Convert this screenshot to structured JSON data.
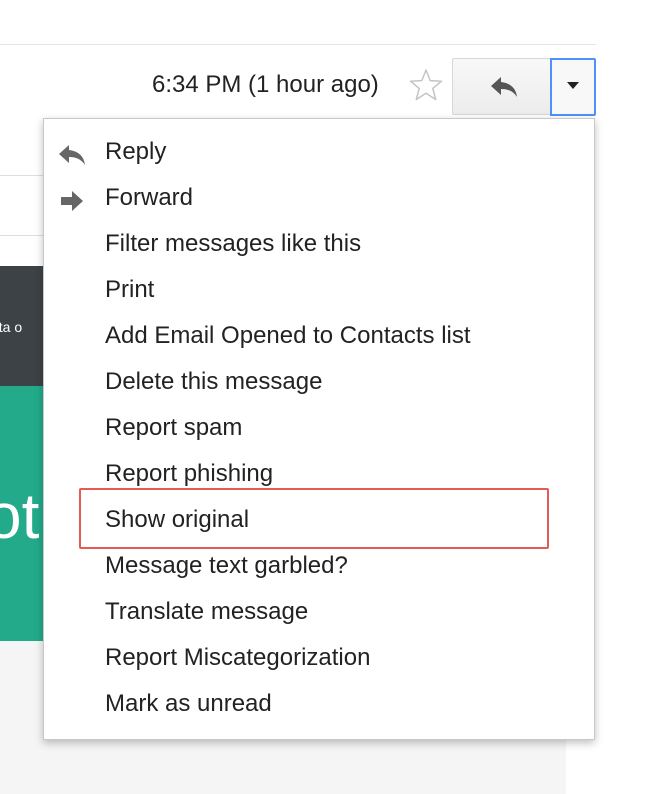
{
  "header": {
    "timestamp": "6:34 PM (1 hour ago)",
    "star_icon": "star-outline-icon",
    "reply_icon": "reply-arrow-icon",
    "more_icon": "caret-down-icon"
  },
  "background": {
    "dark_banner_text": "ata o",
    "green_banner_text": "ot",
    "green_color": "#22aa8b",
    "dark_color": "#3d4246"
  },
  "menu": {
    "items": [
      {
        "label": "Reply",
        "icon": "reply-icon"
      },
      {
        "label": "Forward",
        "icon": "forward-icon"
      },
      {
        "label": "Filter messages like this",
        "icon": ""
      },
      {
        "label": "Print",
        "icon": ""
      },
      {
        "label": "Add Email Opened to Contacts list",
        "icon": ""
      },
      {
        "label": "Delete this message",
        "icon": ""
      },
      {
        "label": "Report spam",
        "icon": ""
      },
      {
        "label": "Report phishing",
        "icon": ""
      },
      {
        "label": "Show original",
        "icon": ""
      },
      {
        "label": "Message text garbled?",
        "icon": ""
      },
      {
        "label": "Translate message",
        "icon": ""
      },
      {
        "label": "Report Miscategorization",
        "icon": ""
      },
      {
        "label": "Mark as unread",
        "icon": ""
      }
    ],
    "highlighted_item": "Show original",
    "highlight_color": "#e35b54",
    "focus_color": "#4d90fe"
  }
}
